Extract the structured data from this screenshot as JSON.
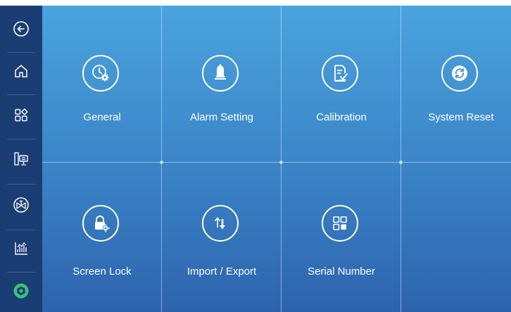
{
  "sidebar": {
    "items": [
      {
        "icon": "back-arrow-icon"
      },
      {
        "icon": "home-icon"
      },
      {
        "icon": "grid-apps-icon"
      },
      {
        "icon": "monitor-device-icon"
      },
      {
        "icon": "valve-icon"
      },
      {
        "icon": "chart-icon"
      },
      {
        "icon": "gear-settings-icon",
        "active": true
      }
    ],
    "background": "#1a3d73",
    "active_color": "#39c27a"
  },
  "tiles": [
    {
      "label": "General",
      "icon": "clock-gear-icon"
    },
    {
      "label": "Alarm Setting",
      "icon": "bell-icon"
    },
    {
      "label": "Calibration",
      "icon": "document-check-icon"
    },
    {
      "label": "System Reset",
      "icon": "refresh-icon"
    },
    {
      "label": "Screen Lock",
      "icon": "lock-gear-icon"
    },
    {
      "label": "Import / Export",
      "icon": "import-export-icon"
    },
    {
      "label": "Serial Number",
      "icon": "qr-grid-icon"
    }
  ],
  "colors": {
    "panel_top": "#4aa3dd",
    "panel_bottom": "#2d63ad"
  }
}
